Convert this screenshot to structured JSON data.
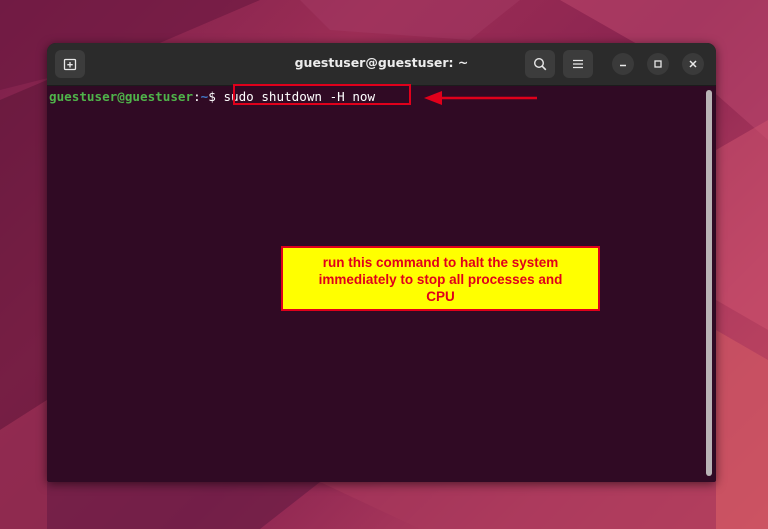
{
  "window": {
    "title": "guestuser@guestuser: ~"
  },
  "terminal": {
    "prompt_user": "guestuser@guestuser",
    "prompt_separator": ":",
    "prompt_path": "~",
    "prompt_symbol": "$",
    "command": "sudo shutdown -H now"
  },
  "annotation": {
    "lines": [
      "run this command to halt the system",
      "immediately to stop all processes and",
      "CPU"
    ]
  },
  "icons": {
    "new_tab": "new-tab-icon",
    "search": "search-icon",
    "menu": "hamburger-menu-icon",
    "minimize": "minimize-icon",
    "maximize": "maximize-icon",
    "close": "close-icon"
  },
  "colors": {
    "terminal_bg": "#300a24",
    "headerbar_bg": "#2b2b2b",
    "prompt_user": "#4fb34a",
    "prompt_path": "#3f78c8",
    "highlight": "#e0001b",
    "callout_bg": "#ffff00"
  }
}
